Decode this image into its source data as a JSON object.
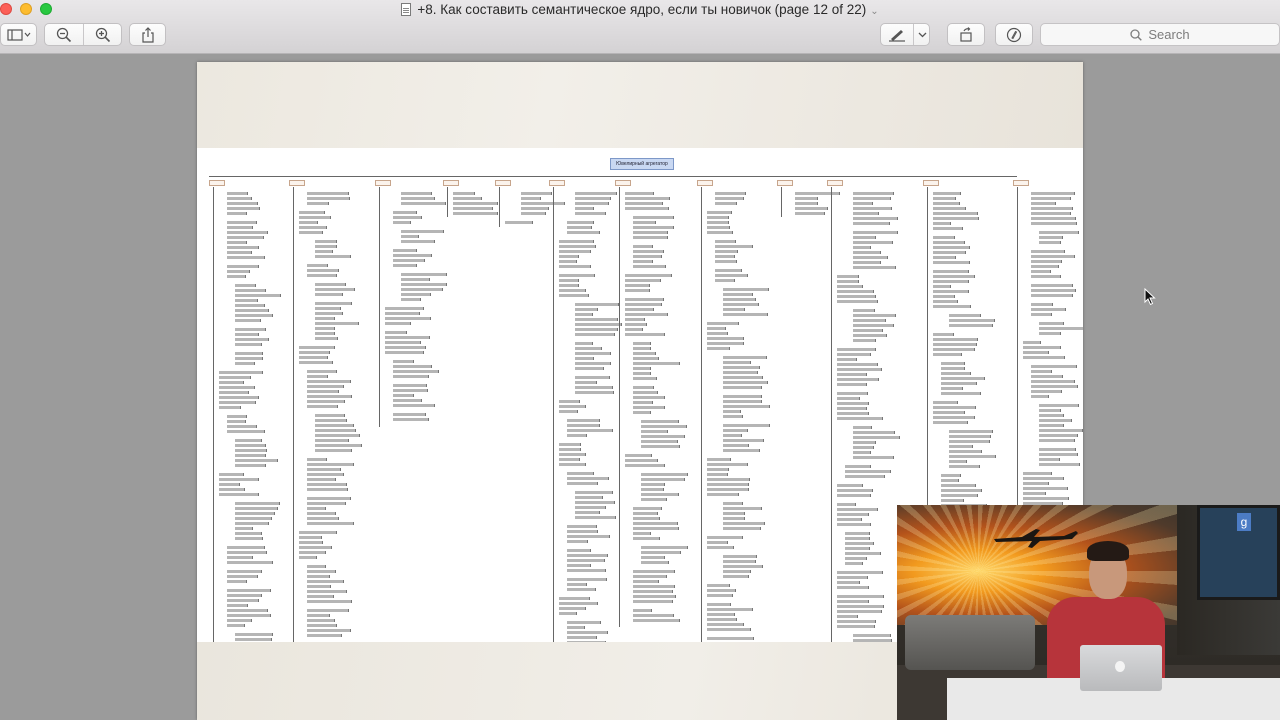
{
  "window": {
    "title": "+8. Как составить семантическое ядро, если ты новичок (page 12 of 22)"
  },
  "toolbar": {
    "search_placeholder": "Search"
  },
  "document": {
    "mindmap_root": "Ювелирный агрегатор"
  },
  "colors": {
    "close": "#fc5f57",
    "minimize": "#fdbc2e",
    "maximize": "#28c840",
    "root_node_fill": "#c9d8f2"
  }
}
